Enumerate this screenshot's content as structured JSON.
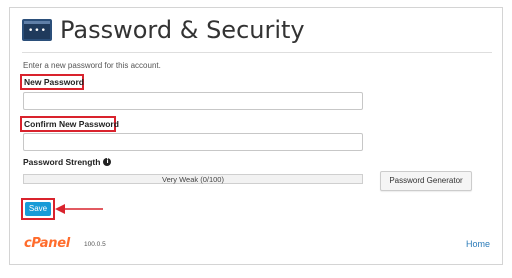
{
  "page": {
    "title": "Password & Security",
    "intro": "Enter a new password for this account."
  },
  "form": {
    "new_password_label": "New Password",
    "new_password_value": "",
    "confirm_password_label": "Confirm New Password",
    "confirm_password_value": "",
    "strength_label": "Password Strength",
    "strength_text": "Very Weak (0/100)",
    "strength_score": 0,
    "generator_button": "Password Generator",
    "save_button": "Save"
  },
  "footer": {
    "logo_text": "cPanel",
    "version": "100.0.5",
    "home_link": "Home"
  },
  "icons": {
    "page_icon": "password-key-icon",
    "info_icon": "info-icon",
    "annotation_arrow": "red-arrow-icon"
  },
  "colors": {
    "highlight": "#d9232d",
    "save_button": "#179bd7",
    "brand_orange": "#ff6c2c",
    "link": "#2b7bb9"
  }
}
